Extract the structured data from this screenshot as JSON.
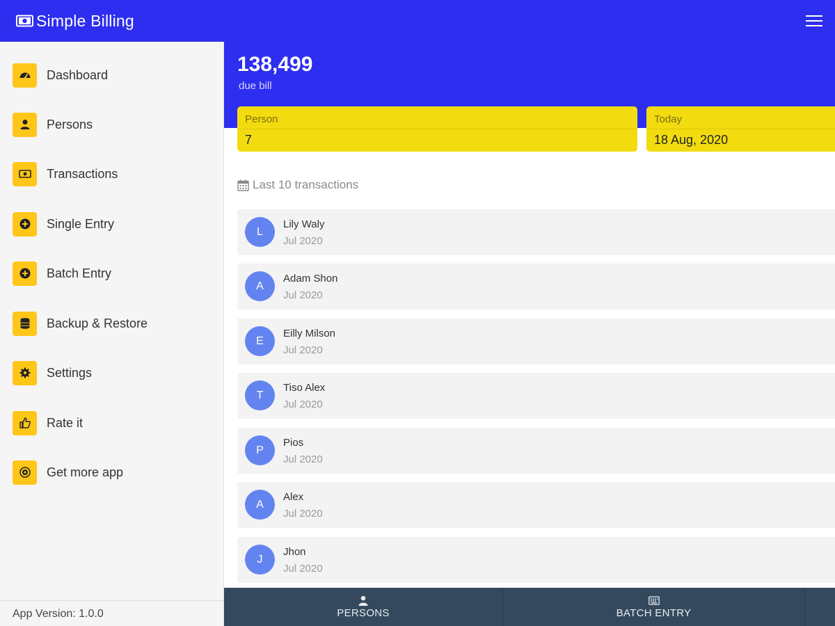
{
  "app": {
    "title": "Simple Billing",
    "icons": {
      "brand": "money-bill-icon",
      "menu": "hamburger-menu-icon"
    },
    "colors": {
      "primary": "#2e2ef0",
      "accent": "#ffc61a",
      "card": "#f2dc10",
      "avatar": "#6384f0",
      "bottombar": "#34495e"
    }
  },
  "sidebar": {
    "items": [
      {
        "label": "Dashboard",
        "icon": "dashboard-icon"
      },
      {
        "label": "Persons",
        "icon": "user-icon"
      },
      {
        "label": "Transactions",
        "icon": "money-bill-icon"
      },
      {
        "label": "Single Entry",
        "icon": "plus-circle-icon"
      },
      {
        "label": "Batch Entry",
        "icon": "plus-circle-icon"
      },
      {
        "label": "Backup & Restore",
        "icon": "database-icon"
      },
      {
        "label": "Settings",
        "icon": "gear-icon"
      },
      {
        "label": "Rate it",
        "icon": "thumbs-up-icon"
      },
      {
        "label": "Get more app",
        "icon": "eye-icon"
      }
    ],
    "version": "App Version: 1.0.0"
  },
  "summary": {
    "due_amount": "138,499",
    "due_label": "due bill",
    "cards": [
      {
        "label": "Person",
        "value": "7"
      },
      {
        "label": "Today",
        "value": "18 Aug, 2020"
      }
    ]
  },
  "transactions": {
    "title": "Last 10 transactions",
    "icon": "calendar-icon",
    "rows": [
      {
        "initial": "L",
        "name": "Lily Waly",
        "date": "Jul 2020"
      },
      {
        "initial": "A",
        "name": "Adam Shon",
        "date": "Jul 2020"
      },
      {
        "initial": "E",
        "name": "Eilly Milson",
        "date": "Jul 2020"
      },
      {
        "initial": "T",
        "name": "Tiso Alex",
        "date": "Jul 2020"
      },
      {
        "initial": "P",
        "name": "Pios",
        "date": "Jul 2020"
      },
      {
        "initial": "A",
        "name": "Alex",
        "date": "Jul 2020"
      },
      {
        "initial": "J",
        "name": "Jhon",
        "date": "Jul 2020"
      }
    ]
  },
  "bottom_nav": {
    "tabs": [
      {
        "label": "PERSONS",
        "icon": "user-icon"
      },
      {
        "label": "BATCH ENTRY",
        "icon": "keyboard-icon"
      }
    ]
  }
}
